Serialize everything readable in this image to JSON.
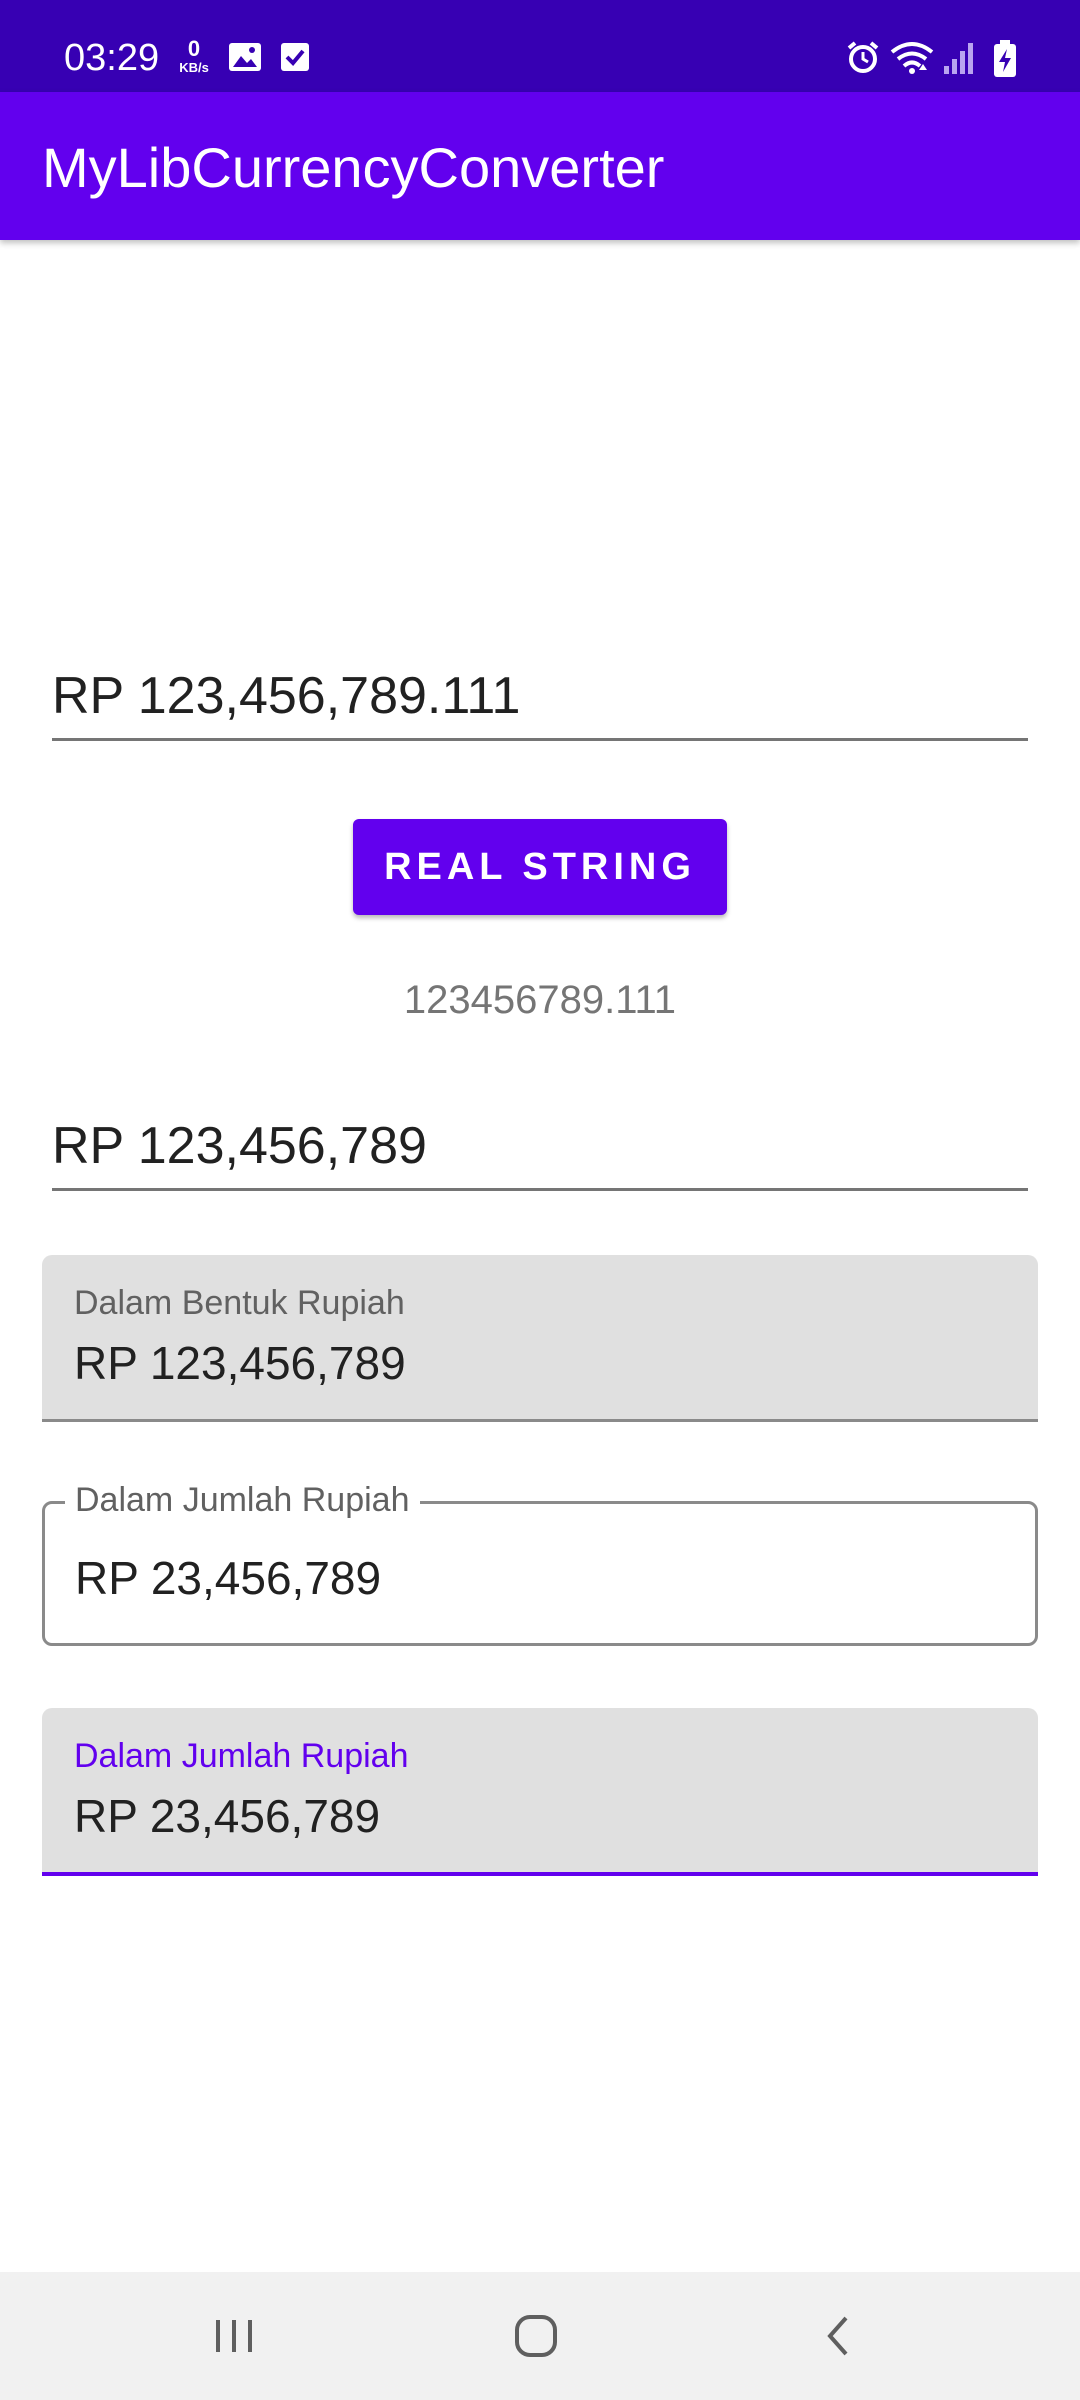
{
  "status_bar": {
    "time": "03:29",
    "net_speed_value": "0",
    "net_speed_unit": "KB/s",
    "bg_color": "#3700b3",
    "left_icons": [
      "gallery-icon",
      "checkbox-notification-icon"
    ],
    "right_icons": [
      "alarm-icon",
      "wifi-icon",
      "signal-icon",
      "battery-charging-icon"
    ]
  },
  "app_bar": {
    "title": "MyLibCurrencyConverter",
    "bg_color": "#6200ee"
  },
  "main": {
    "input_real": {
      "value": "RP 123,456,789.111"
    },
    "real_string_button": {
      "label": "REAL STRING"
    },
    "real_string_result": "123456789.111",
    "input_integer": {
      "value": "RP 123,456,789"
    },
    "field_bentuk_filled": {
      "label": "Dalam Bentuk Rupiah",
      "value": "RP 123,456,789"
    },
    "field_jumlah_outlined": {
      "label": "Dalam Jumlah Rupiah",
      "value": "RP 23,456,789"
    },
    "field_jumlah_filled_focused": {
      "label": "Dalam Jumlah Rupiah",
      "value": "RP 23,456,789",
      "accent_color": "#6200ee"
    }
  },
  "nav_bar": {
    "buttons": [
      "recent-apps-icon",
      "home-icon",
      "back-icon"
    ]
  }
}
